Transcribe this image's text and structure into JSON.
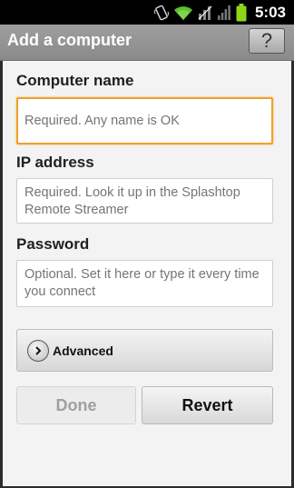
{
  "status_bar": {
    "time": "5:03",
    "icons": [
      "vibrate-icon",
      "wifi-icon",
      "no-signal-icon",
      "signal-icon",
      "battery-icon"
    ]
  },
  "header": {
    "title": "Add a computer",
    "help_label": "?"
  },
  "form": {
    "computer_name": {
      "label": "Computer name",
      "placeholder": "Required. Any name is OK",
      "value": ""
    },
    "ip_address": {
      "label": "IP address",
      "placeholder": "Required. Look it up in the Splashtop Remote Streamer",
      "value": ""
    },
    "password": {
      "label": "Password",
      "placeholder": "Optional. Set it here or type it every time you connect",
      "value": ""
    },
    "advanced_label": "Advanced"
  },
  "actions": {
    "done_label": "Done",
    "revert_label": "Revert"
  },
  "colors": {
    "focus_border": "#f0a030",
    "battery": "#8fd31b"
  }
}
